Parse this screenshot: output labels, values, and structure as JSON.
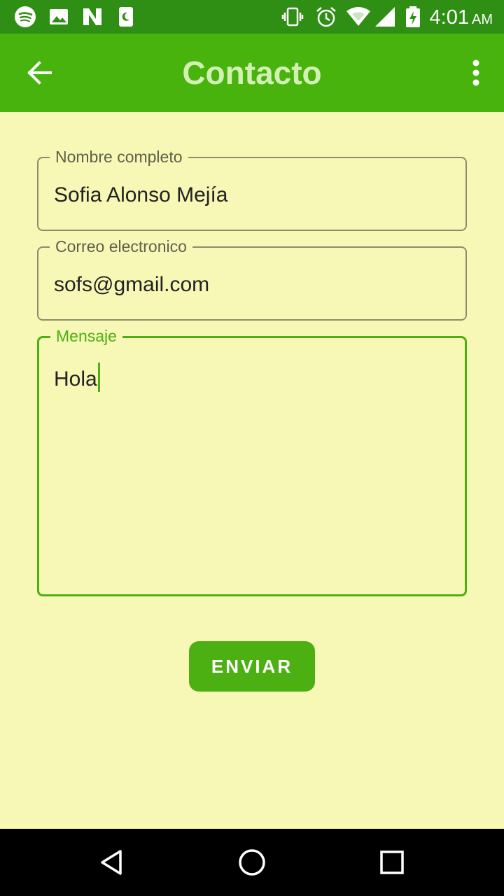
{
  "status_bar": {
    "time": "4:01",
    "ampm": "AM",
    "left_icons": [
      "spotify-icon",
      "image-icon",
      "news-icon",
      "sleep-icon"
    ],
    "right_icons": [
      "vibrate-icon",
      "alarm-icon",
      "wifi-icon",
      "signal-icon",
      "battery-icon"
    ]
  },
  "app_bar": {
    "title": "Contacto",
    "back_icon": "arrow-left-icon",
    "menu_icon": "more-vert-icon"
  },
  "form": {
    "name": {
      "label": "Nombre completo",
      "value": "Sofia Alonso Mejía"
    },
    "email": {
      "label": "Correo electronico",
      "value": "sofs@gmail.com"
    },
    "message": {
      "label": "Mensaje",
      "value": "Hola"
    },
    "submit_label": "ENVIAR"
  },
  "nav_bar": {
    "icons": [
      "back-triangle-icon",
      "home-circle-icon",
      "recents-square-icon"
    ]
  },
  "colors": {
    "status_bar": "#2f8f14",
    "app_bar": "#48b30d",
    "background": "#f7f7b6",
    "accent": "#4cb012",
    "title_text": "#d3f0b4"
  }
}
